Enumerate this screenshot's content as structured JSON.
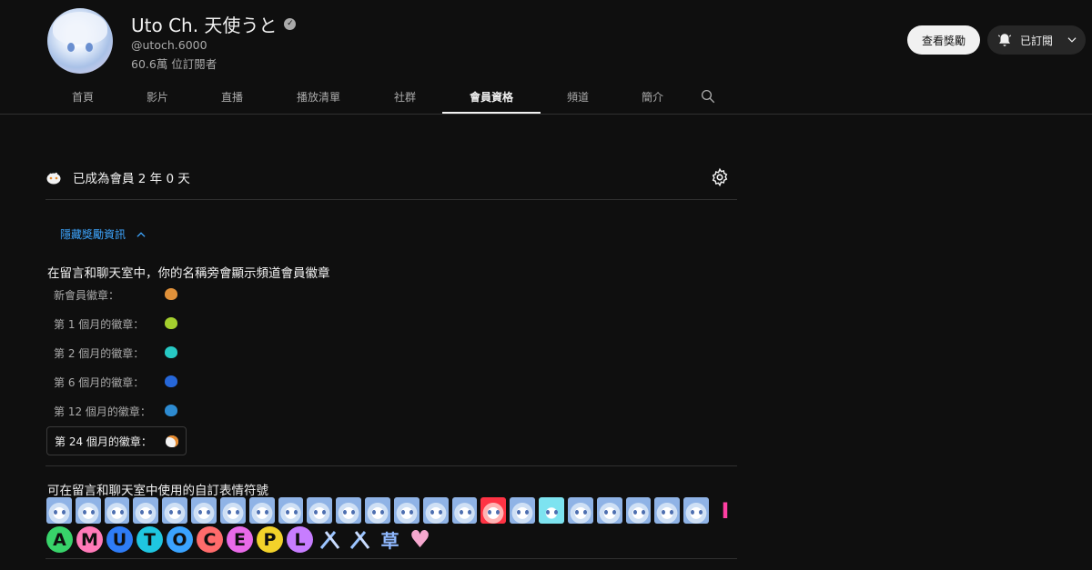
{
  "channel": {
    "name": "Uto Ch. 天使うと",
    "handle": "@utoch.6000",
    "subscribers": "60.6萬 位訂閱者"
  },
  "actions": {
    "perks_label": "查看獎勵",
    "subscribed_label": "已訂閱"
  },
  "tabs": [
    {
      "label": "首頁"
    },
    {
      "label": "影片"
    },
    {
      "label": "直播"
    },
    {
      "label": "播放清單"
    },
    {
      "label": "社群"
    },
    {
      "label": "會員資格",
      "active": true
    },
    {
      "label": "頻道"
    },
    {
      "label": "簡介"
    }
  ],
  "membership": {
    "since": "已成為會員 2 年 0 天",
    "hide_perks": "隱藏獎勵資訊",
    "badge_heading": "在留言和聊天室中，你的名稱旁會顯示頻道會員徽章",
    "badges": [
      {
        "label": "新會員徽章：",
        "color": "#e0913a"
      },
      {
        "label": "第 1 個月的徽章：",
        "color": "#a4cf2e"
      },
      {
        "label": "第 2 個月的徽章：",
        "color": "#27c9c4"
      },
      {
        "label": "第 6 個月的徽章：",
        "color": "#2667d9"
      },
      {
        "label": "第 12 個月的徽章：",
        "color": "#2d8bd1"
      },
      {
        "label": "第 24 個月的徽章：",
        "color": "#f3f3f3",
        "current": true
      }
    ],
    "emoji_heading": "可在留言和聊天室中使用的自訂表情符號",
    "emoji_row1_count": 23,
    "emoji_letters": [
      {
        "char": "I",
        "color": "#ff3fa2",
        "shape": "bar"
      },
      {
        "char": "A",
        "color": "#38d36a"
      },
      {
        "char": "M",
        "color": "#ff7ab8"
      },
      {
        "char": "U",
        "color": "#2e7cf6"
      },
      {
        "char": "T",
        "color": "#1fc6e0"
      },
      {
        "char": "O",
        "color": "#3aa3ff"
      },
      {
        "char": "C",
        "color": "#ff6b6b"
      },
      {
        "char": "E",
        "color": "#e86ae8"
      },
      {
        "char": "P",
        "color": "#f2d22a"
      },
      {
        "char": "L",
        "color": "#c77dff"
      }
    ],
    "emoji_grass": "草",
    "emoji_heart": "♥"
  },
  "colors": {
    "accent_link": "#3ea6ff",
    "background": "#0f0f0f"
  }
}
